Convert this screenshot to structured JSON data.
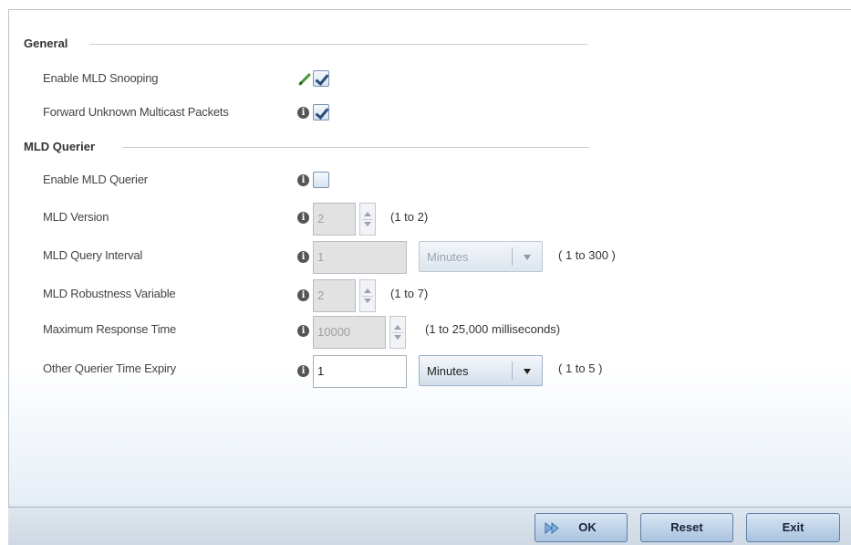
{
  "general": {
    "title": "General",
    "enable_mld_snooping": {
      "label": "Enable MLD Snooping",
      "checked": true
    },
    "forward_unknown_multicast": {
      "label": "Forward Unknown Multicast Packets",
      "checked": true
    }
  },
  "querier": {
    "title": "MLD Querier",
    "enable_mld_querier": {
      "label": "Enable MLD Querier",
      "checked": false
    },
    "mld_version": {
      "label": "MLD Version",
      "value": "2",
      "range": "(1 to 2)"
    },
    "query_interval": {
      "label": "MLD Query Interval",
      "value": "1",
      "unit": "Minutes",
      "range": "( 1 to 300 )"
    },
    "robustness": {
      "label": "MLD Robustness Variable",
      "value": "2",
      "range": "(1 to 7)"
    },
    "max_response": {
      "label": "Maximum Response Time",
      "value": "10000",
      "range": "(1 to 25,000 milliseconds)"
    },
    "other_querier_expiry": {
      "label": "Other Querier Time Expiry",
      "value": "1",
      "unit": "Minutes",
      "range": "( 1 to 5 )"
    }
  },
  "icons": {
    "info": "i"
  },
  "footer": {
    "ok_label": "OK",
    "reset_label": "Reset",
    "exit_label": "Exit"
  }
}
